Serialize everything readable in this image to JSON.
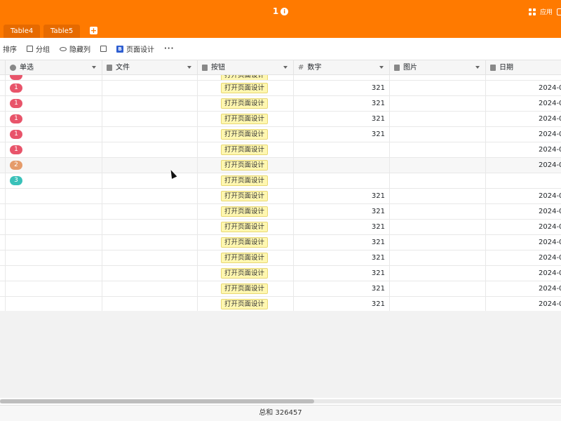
{
  "header": {
    "title": "1",
    "info_icon": "i",
    "apps_label": "应用"
  },
  "tabs": [
    {
      "label": "Table4"
    },
    {
      "label": "Table5"
    }
  ],
  "toolbar": {
    "sort_label": "排序",
    "group_label": "分组",
    "hide_columns_label": "隐藏列",
    "page_design_label": "页面设计",
    "more_label": "···"
  },
  "columns": [
    {
      "label": "单选"
    },
    {
      "label": "文件"
    },
    {
      "label": "按钮"
    },
    {
      "label": "数字"
    },
    {
      "label": "图片"
    },
    {
      "label": "日期"
    }
  ],
  "colors": {
    "brand": "#ff7a00",
    "option_1": "#e8546a",
    "option_2": "#e59b6a",
    "option_3": "#39c1b9"
  },
  "rows": [
    {
      "option": "1",
      "button": "打开页面设计",
      "number": "321",
      "date": "2024-0"
    },
    {
      "option": "1",
      "button": "打开页面设计",
      "number": "321",
      "date": "2024-0"
    },
    {
      "option": "1",
      "button": "打开页面设计",
      "number": "321",
      "date": "2024-0"
    },
    {
      "option": "1",
      "button": "打开页面设计",
      "number": "321",
      "date": "2024-0"
    },
    {
      "option": "1",
      "button": "打开页面设计",
      "number": "",
      "date": "2024-0"
    },
    {
      "option": "2",
      "button": "打开页面设计",
      "number": "",
      "date": "2024-0"
    },
    {
      "option": "3",
      "button": "打开页面设计",
      "number": "",
      "date": ""
    },
    {
      "option": "",
      "button": "打开页面设计",
      "number": "321",
      "date": "2024-0"
    },
    {
      "option": "",
      "button": "打开页面设计",
      "number": "321",
      "date": "2024-0"
    },
    {
      "option": "",
      "button": "打开页面设计",
      "number": "321",
      "date": "2024-0"
    },
    {
      "option": "",
      "button": "打开页面设计",
      "number": "321",
      "date": "2024-0"
    },
    {
      "option": "",
      "button": "打开页面设计",
      "number": "321",
      "date": "2024-0"
    },
    {
      "option": "",
      "button": "打开页面设计",
      "number": "321",
      "date": "2024-0"
    },
    {
      "option": "",
      "button": "打开页面设计",
      "number": "321",
      "date": "2024-0"
    },
    {
      "option": "",
      "button": "打开页面设计",
      "number": "321",
      "date": "2024-0"
    }
  ],
  "footer": {
    "summary": "总和 326457"
  }
}
